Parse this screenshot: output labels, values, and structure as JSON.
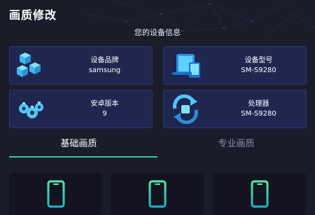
{
  "page_title": "画质修改",
  "device_info": {
    "title": "您的设备信息",
    "cards": [
      {
        "icon": "cubes-icon",
        "label": "设备品牌",
        "value": "samsung"
      },
      {
        "icon": "devices-icon",
        "label": "设备型号",
        "value": "SM-S9280"
      },
      {
        "icon": "gears-icon",
        "label": "安卓版本",
        "value": "9"
      },
      {
        "icon": "processor-refresh-icon",
        "label": "处理器",
        "value": "SM-S9280"
      }
    ]
  },
  "tabs": [
    {
      "label": "基础画质",
      "active": true
    },
    {
      "label": "专业画质",
      "active": false
    }
  ],
  "quality_options": [
    {
      "icon": "phone-icon"
    },
    {
      "icon": "phone-icon"
    },
    {
      "icon": "phone-icon"
    }
  ],
  "colors": {
    "accent": "#39c79b",
    "card_bg": "#1f2750",
    "background": "#1b1c2a"
  }
}
